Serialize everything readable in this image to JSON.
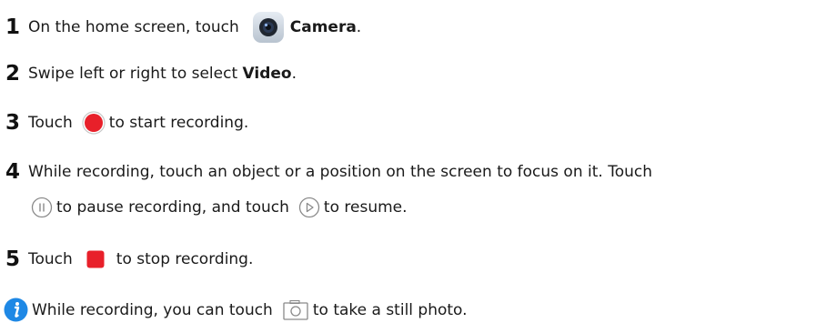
{
  "steps": [
    {
      "number": "1",
      "text_before": "On the home screen, touch",
      "bold": "Camera",
      "text_after": "."
    },
    {
      "number": "2",
      "text_before": "Swipe left or right to select",
      "bold": "Video",
      "text_after": "."
    },
    {
      "number": "3",
      "text_before": "Touch",
      "text_after": "to start recording."
    },
    {
      "number": "4",
      "line1": "While recording, touch an object or a position on the screen to focus on it. Touch",
      "line2_a": "to pause recording, and touch",
      "line2_b": "to resume."
    },
    {
      "number": "5",
      "text_before": "Touch",
      "text_after": "to stop recording."
    }
  ],
  "note": {
    "text_before": "While recording, you can touch",
    "text_after": "to take a still photo."
  },
  "colors": {
    "record_red": "#e8202a",
    "info_blue": "#1e88e5",
    "icon_gray": "#8a8a8a"
  },
  "icons": [
    "camera-app-icon",
    "record-button-icon",
    "pause-button-icon",
    "resume-button-icon",
    "stop-button-icon",
    "info-icon",
    "capture-photo-icon"
  ]
}
